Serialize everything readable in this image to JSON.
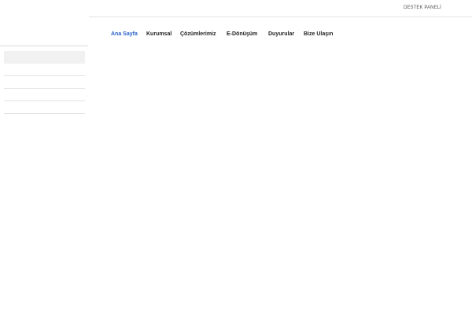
{
  "topbar": {
    "support_link": "DESTEK PANELİ"
  },
  "nav": {
    "items": [
      {
        "label": "Ana Sayfa",
        "active": true
      },
      {
        "label": "Kurumsal",
        "active": false
      },
      {
        "label": "Çözümlerimiz",
        "active": false
      },
      {
        "label": "E-Dönüşüm",
        "active": false
      },
      {
        "label": "Duyurular",
        "active": false
      },
      {
        "label": "Bize Ulaşın",
        "active": false
      }
    ]
  },
  "sidebar": {
    "items": [
      "",
      "",
      "",
      "",
      "",
      ""
    ]
  },
  "colors": {
    "accent": "#2b62c7",
    "nav_text": "#222222",
    "divider": "#e4e4e4",
    "active_bg": "#f1f1f1"
  }
}
